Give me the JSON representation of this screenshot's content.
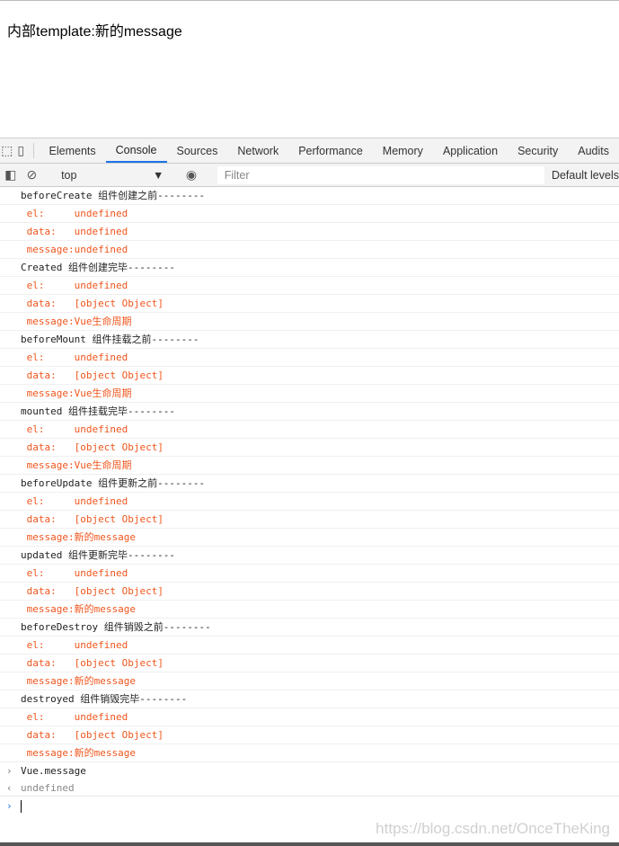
{
  "page": {
    "text": "内部template:新的message"
  },
  "devtools": {
    "tabs": [
      "Elements",
      "Console",
      "Sources",
      "Network",
      "Performance",
      "Memory",
      "Application",
      "Security",
      "Audits"
    ],
    "active_tab": "Console",
    "context": "top",
    "filter_placeholder": "Filter",
    "levels": "Default levels"
  },
  "logs": [
    {
      "text": "beforeCreate 组件创建之前--------",
      "type": "log"
    },
    {
      "text": " el:     undefined",
      "type": "warn"
    },
    {
      "text": " data:   undefined",
      "type": "warn"
    },
    {
      "text": " message:undefined",
      "type": "warn"
    },
    {
      "text": "Created 组件创建完毕--------",
      "type": "log"
    },
    {
      "text": " el:     undefined",
      "type": "warn"
    },
    {
      "text": " data:   [object Object]",
      "type": "warn"
    },
    {
      "text": " message:Vue生命周期",
      "type": "warn"
    },
    {
      "text": "beforeMount 组件挂载之前--------",
      "type": "log"
    },
    {
      "text": " el:     undefined",
      "type": "warn"
    },
    {
      "text": " data:   [object Object]",
      "type": "warn"
    },
    {
      "text": " message:Vue生命周期",
      "type": "warn"
    },
    {
      "text": "mounted 组件挂载完毕--------",
      "type": "log"
    },
    {
      "text": " el:     undefined",
      "type": "warn"
    },
    {
      "text": " data:   [object Object]",
      "type": "warn"
    },
    {
      "text": " message:Vue生命周期",
      "type": "warn"
    },
    {
      "text": "beforeUpdate 组件更新之前--------",
      "type": "log"
    },
    {
      "text": " el:     undefined",
      "type": "warn"
    },
    {
      "text": " data:   [object Object]",
      "type": "warn"
    },
    {
      "text": " message:新的message",
      "type": "warn"
    },
    {
      "text": "updated 组件更新完毕--------",
      "type": "log"
    },
    {
      "text": " el:     undefined",
      "type": "warn"
    },
    {
      "text": " data:   [object Object]",
      "type": "warn"
    },
    {
      "text": " message:新的message",
      "type": "warn"
    },
    {
      "text": "beforeDestroy 组件销毁之前--------",
      "type": "log"
    },
    {
      "text": " el:     undefined",
      "type": "warn"
    },
    {
      "text": " data:   [object Object]",
      "type": "warn"
    },
    {
      "text": " message:新的message",
      "type": "warn"
    },
    {
      "text": "destroyed 组件销毁完毕--------",
      "type": "log"
    },
    {
      "text": " el:     undefined",
      "type": "warn"
    },
    {
      "text": " data:   [object Object]",
      "type": "warn"
    },
    {
      "text": " message:新的message",
      "type": "warn"
    }
  ],
  "command": "Vue.message",
  "result": "undefined",
  "watermark": "https://blog.csdn.net/OnceTheKing",
  "colors": {
    "warn_text": "#f0561d",
    "active_tab": "#1a73e8"
  }
}
